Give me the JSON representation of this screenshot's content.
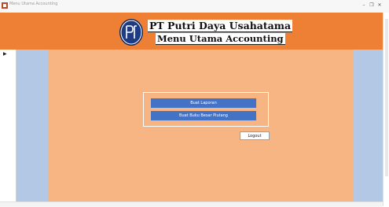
{
  "window": {
    "title": "Menu Utama Accounting",
    "minimize_glyph": "–",
    "restore_glyph": "❐",
    "close_glyph": "✕"
  },
  "header": {
    "company_name": "PT Putri Daya Usahatama",
    "menu_title": "Menu Utama Accounting"
  },
  "menu": {
    "buttons": [
      {
        "label": "Buat Laporan"
      },
      {
        "label": "Buat Buku Besar Piutang"
      }
    ],
    "logout_label": "Logout"
  },
  "nav": {
    "record_selector_glyph": "▶"
  },
  "colors": {
    "header_bg": "#ed8035",
    "main_bg": "#f6b583",
    "side_panel_bg": "#b3c8e4",
    "button_bg": "#4472c4",
    "logo_bg": "#1d3c82"
  },
  "icons": {
    "app": "access-form-icon",
    "logo": "company-logo-icon"
  }
}
